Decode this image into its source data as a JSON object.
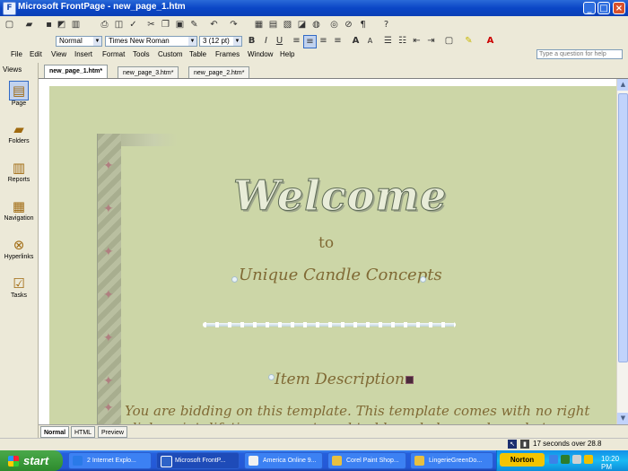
{
  "window": {
    "title": "Microsoft FrontPage - new_page_1.htm",
    "app_icon": "frontpage-icon",
    "controls": {
      "minimize": "_",
      "maximize": "□",
      "close": "×"
    }
  },
  "toolbar": {
    "style": "Normal",
    "font": "Times New Roman",
    "size": "3  (12 pt)",
    "bold": "B",
    "italic": "I",
    "underline": "U",
    "large_a": "A",
    "small_a": "A"
  },
  "menu": [
    "File",
    "Edit",
    "View",
    "Insert",
    "Format",
    "Tools",
    "Custom",
    "Table",
    "Frames",
    "Window",
    "Help"
  ],
  "help_box": {
    "placeholder": "Type a question for help"
  },
  "views": {
    "header": "Views",
    "items": [
      {
        "label": "Page",
        "icon": "page-view-icon",
        "glyph": "▤"
      },
      {
        "label": "Folders",
        "icon": "folders-icon",
        "glyph": "▰"
      },
      {
        "label": "Reports",
        "icon": "reports-icon",
        "glyph": "▥"
      },
      {
        "label": "Navigation",
        "icon": "navigation-icon",
        "glyph": "▦"
      },
      {
        "label": "Hyperlinks",
        "icon": "hyperlinks-icon",
        "glyph": "⊗"
      },
      {
        "label": "Tasks",
        "icon": "tasks-icon",
        "glyph": "☑"
      }
    ]
  },
  "tabs": [
    "new_page_1.htm*",
    "new_page_3.htm*",
    "new_page_2.htm*"
  ],
  "page": {
    "welcome": "Welcome",
    "to": "to",
    "company": "Unique Candle Concepts",
    "item": "Item Description",
    "body": "You are bidding on this template. This template comes with no right click script, lifetime support, no html knowledge, and no photo hosting"
  },
  "mode_tabs": [
    "Normal",
    "HTML",
    "Preview"
  ],
  "status": {
    "text": "17 seconds over 28.8"
  },
  "taskbar": {
    "start": "start",
    "items": [
      {
        "label": "2 Internet Explo...",
        "color": "#3c7be0"
      },
      {
        "label": "Microsoft FrontP...",
        "color": "#2e63c8"
      },
      {
        "label": "America Online 9...",
        "color": "#1f5fd6"
      },
      {
        "label": "Corel Paint Shop...",
        "color": "#3a86f0"
      },
      {
        "label": "LingerieGreenDo...",
        "color": "#3a86f0"
      }
    ],
    "norton": "Norton",
    "clock": "10:20 PM"
  },
  "colors": {
    "page_bg": "#ccd6a7",
    "text_brown": "#806a35",
    "star": "#b07f80"
  }
}
